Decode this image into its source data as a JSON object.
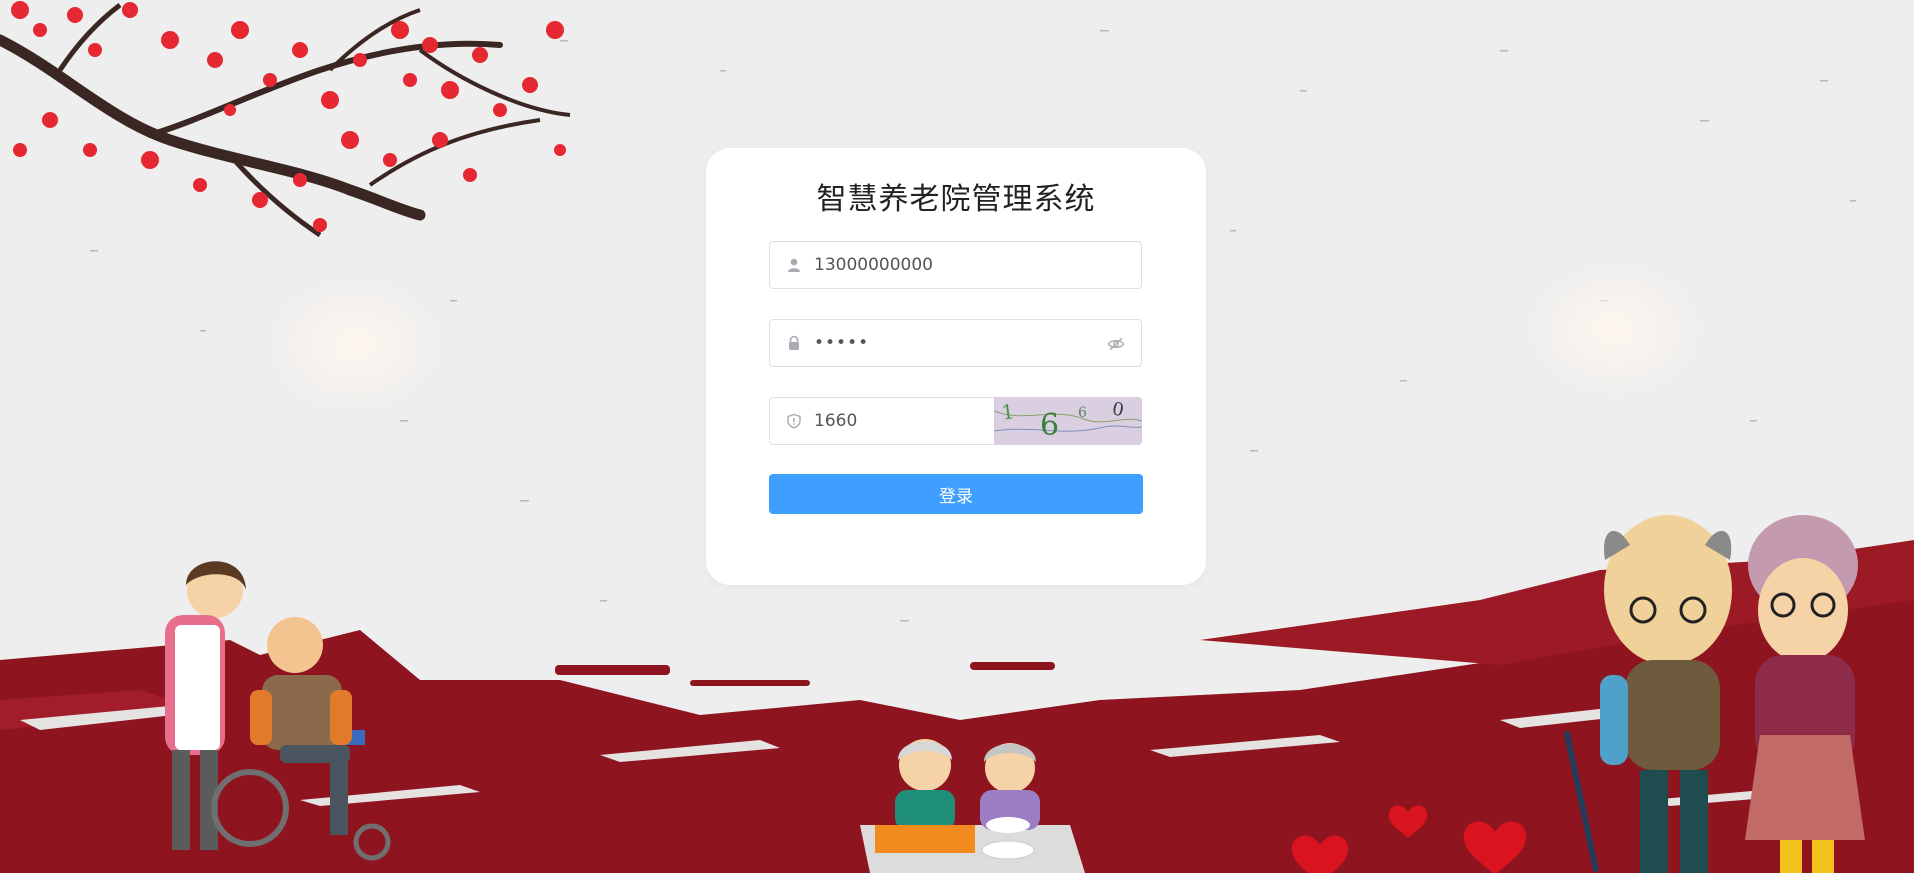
{
  "app": {
    "title": "智慧养老院管理系统"
  },
  "login_form": {
    "username_value": "13000000000",
    "password_value": "•••••",
    "captcha_input_value": "1660",
    "captcha_image_text": [
      "1",
      "6",
      "6",
      "0"
    ],
    "login_label": "登录"
  },
  "colors": {
    "primary": "#409eff",
    "blossom": "#e52832",
    "ground": "#8e1420",
    "background": "#eeeeee"
  },
  "icons": {
    "username": "user-icon",
    "password": "lock-icon",
    "password_toggle": "eye-off-icon",
    "captcha": "shield-icon"
  }
}
